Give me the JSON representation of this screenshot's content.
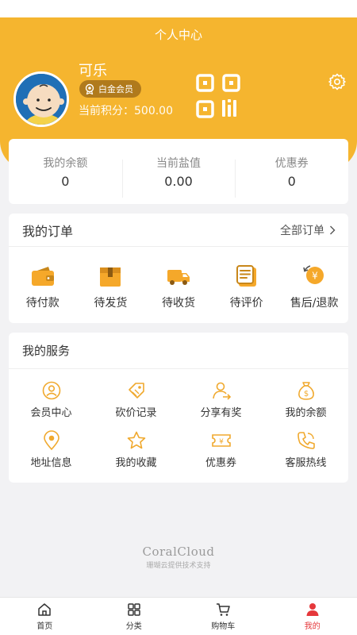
{
  "header": {
    "title": "个人中心",
    "username": "可乐",
    "member_level": "白金会员",
    "points_label": "当前积分：",
    "points_value": "500.00"
  },
  "stats": [
    {
      "label": "我的余额",
      "value": "0"
    },
    {
      "label": "当前盐值",
      "value": "0.00"
    },
    {
      "label": "优惠券",
      "value": "0"
    }
  ],
  "orders": {
    "title": "我的订单",
    "all_label": "全部订单",
    "items": [
      {
        "label": "待付款",
        "icon": "wallet-icon"
      },
      {
        "label": "待发货",
        "icon": "box-icon"
      },
      {
        "label": "待收货",
        "icon": "truck-icon"
      },
      {
        "label": "待评价",
        "icon": "review-icon"
      },
      {
        "label": "售后/退款",
        "icon": "refund-icon"
      }
    ]
  },
  "services": {
    "title": "我的服务",
    "items": [
      {
        "label": "会员中心",
        "icon": "member-icon"
      },
      {
        "label": "砍价记录",
        "icon": "bargain-icon"
      },
      {
        "label": "分享有奖",
        "icon": "share-icon"
      },
      {
        "label": "我的余额",
        "icon": "money-bag-icon"
      },
      {
        "label": "地址信息",
        "icon": "location-icon"
      },
      {
        "label": "我的收藏",
        "icon": "star-icon"
      },
      {
        "label": "优惠券",
        "icon": "coupon-icon"
      },
      {
        "label": "客服热线",
        "icon": "phone-icon"
      }
    ]
  },
  "footer": {
    "brand": "CoralCloud",
    "sub": "珊瑚云提供技术支持"
  },
  "tabbar": [
    {
      "label": "首页",
      "icon": "home-icon",
      "active": false
    },
    {
      "label": "分类",
      "icon": "grid-icon",
      "active": false
    },
    {
      "label": "购物车",
      "icon": "cart-icon",
      "active": false
    },
    {
      "label": "我的",
      "icon": "user-icon",
      "active": true
    }
  ],
  "colors": {
    "primary": "#f5b52f",
    "badge": "#b07a1c",
    "active_tab": "#e5383b",
    "background": "#f2f2f4"
  }
}
